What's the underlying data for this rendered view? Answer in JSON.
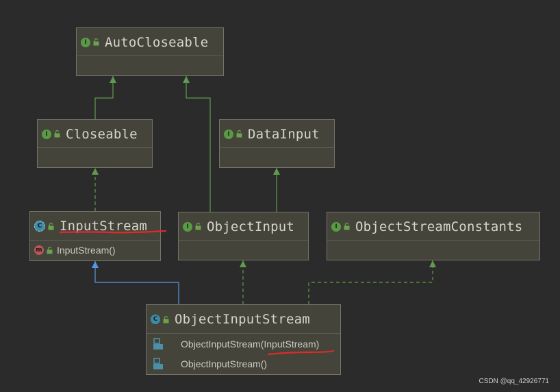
{
  "nodes": {
    "autocloseable": {
      "kind": "I",
      "title": "AutoCloseable"
    },
    "closeable": {
      "kind": "I",
      "title": "Closeable"
    },
    "datainput": {
      "kind": "I",
      "title": "DataInput"
    },
    "inputstream": {
      "kind": "C",
      "kind_label": "C",
      "title": "InputStream",
      "abstract": true,
      "members": [
        {
          "kind": "m",
          "label": "InputStream()"
        }
      ]
    },
    "objectinput": {
      "kind": "I",
      "title": "ObjectInput"
    },
    "objectstreamconstants": {
      "kind": "I",
      "title": "ObjectStreamConstants"
    },
    "objectinputstream": {
      "kind": "C",
      "kind_label": "C",
      "title": "ObjectInputStream",
      "members": [
        {
          "kind": "constructor",
          "label": "ObjectInputStream(InputStream)"
        },
        {
          "kind": "constructor",
          "label": "ObjectInputStream()"
        }
      ]
    }
  },
  "relations": [
    {
      "from": "Closeable",
      "to": "AutoCloseable",
      "type": "extends"
    },
    {
      "from": "ObjectInput",
      "to": "AutoCloseable",
      "type": "extends"
    },
    {
      "from": "ObjectInput",
      "to": "DataInput",
      "type": "extends"
    },
    {
      "from": "InputStream",
      "to": "Closeable",
      "type": "implements"
    },
    {
      "from": "ObjectInputStream",
      "to": "InputStream",
      "type": "extends"
    },
    {
      "from": "ObjectInputStream",
      "to": "ObjectInput",
      "type": "implements"
    },
    {
      "from": "ObjectInputStream",
      "to": "ObjectStreamConstants",
      "type": "implements"
    }
  ],
  "colors": {
    "background": "#2b2b2b",
    "node_fill": "#45443a",
    "interface_edge": "#5f9a4e",
    "class_edge": "#5896e0",
    "interface_badge": "#5b9a45",
    "class_badge": "#3f8ba7",
    "method_badge": "#b2585c",
    "annotation": "#e02a2a"
  },
  "watermark": "CSDN @qq_42926771"
}
